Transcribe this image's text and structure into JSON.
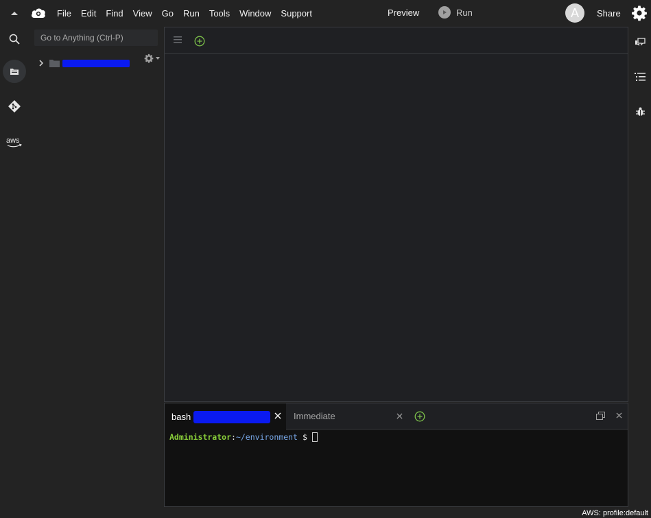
{
  "menubar": {
    "menus": [
      "File",
      "Edit",
      "Find",
      "View",
      "Go",
      "Run",
      "Tools",
      "Window",
      "Support"
    ],
    "preview_label": "Preview",
    "run_label": "Run",
    "avatar_letter": "A",
    "share_label": "Share"
  },
  "explorer": {
    "goto_placeholder": "Go to Anything (Ctrl-P)"
  },
  "terminal": {
    "tabs": [
      {
        "label": "bash"
      },
      {
        "label": "Immediate"
      }
    ],
    "prompt_user": "Administrator",
    "prompt_colon": ":",
    "prompt_path": "~/environment",
    "prompt_symbol": "$"
  },
  "activity": {
    "aws_label": "aws"
  },
  "status": {
    "profile": "AWS: profile:default"
  },
  "colors": {
    "background": "#232323",
    "editor_bg": "#1f2023",
    "terminal_bg": "#111111",
    "accent_green": "#8ad03a",
    "path_blue": "#79a8e8",
    "redaction": "#0a1af0"
  }
}
